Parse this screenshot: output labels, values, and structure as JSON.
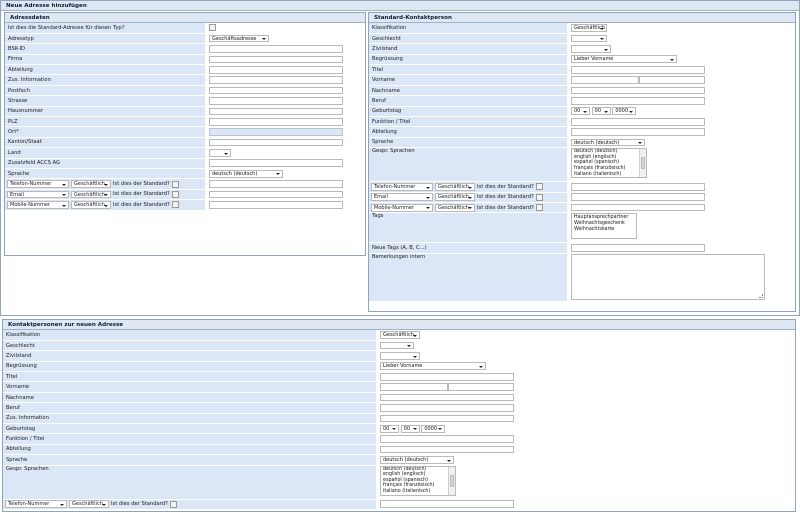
{
  "page": {
    "title": "Neue Adresse hinzufügen"
  },
  "address": {
    "title": "Adressdaten",
    "standard_question": "Ist dies die Standard-Adresse für diesen Typ?",
    "labels": [
      "Adresstyp",
      "BSK-ID",
      "Firma",
      "Abteilung",
      "Zus. Information",
      "Postfach",
      "Strasse",
      "Hausnummer",
      "PLZ",
      "Ort*",
      "Kanton/Staat",
      "Land",
      "Zusatzfeld ACCS AG",
      "Sprache"
    ],
    "adresstyp_value": "Geschäftsadresse",
    "sprache_value": "deutsch (deutsch)",
    "comm": [
      {
        "type": "Telefon-Nummer",
        "scope": "Geschäftlich",
        "question": "Ist dies der Standard?"
      },
      {
        "type": "Email",
        "scope": "Geschäftlich",
        "question": "Ist dies der Standard?"
      },
      {
        "type": "Mobile-Nummer",
        "scope": "Geschäftlich",
        "question": "Ist dies der Standard?"
      }
    ]
  },
  "standard_contact": {
    "title": "Standard-Kontaktperson",
    "labels": {
      "klassifikation": "Klassifikation",
      "geschlecht": "Geschlecht",
      "zivilstand": "Zivilstand",
      "begruessung": "Begrüssung",
      "titel": "Titel",
      "vorname": "Vorname",
      "nachname": "Nachname",
      "beruf": "Beruf",
      "geburtstag": "Geburtstag",
      "funktion": "Funktion / Titel",
      "abteilung": "Abteilung",
      "sprache": "Sprache",
      "gespr_sprachen": "Gespr. Sprachen",
      "tags": "Tags",
      "neue_tags": "Neue Tags (A, B, C...)",
      "bemerkungen": "Bemerkungen intern"
    },
    "klassifikation_value": "Geschäftlich",
    "begruessung_value": "Lieber Vorname",
    "birthday": {
      "day": "00",
      "month": "00",
      "year": "0000"
    },
    "sprache_value": "deutsch (deutsch)",
    "languages": [
      "deutsch (deutsch)",
      "english (englisch)",
      "español (spanisch)",
      "français (französisch)",
      "italiano (italienisch)"
    ],
    "tags": [
      "Hauptansprechpartner",
      "Weihnachtsgeschenk",
      "Weihnachtskarte"
    ],
    "comm": [
      {
        "type": "Telefon-Nummer",
        "scope": "Geschäftlich",
        "question": "Ist dies der Standard?"
      },
      {
        "type": "Email",
        "scope": "Geschäftlich",
        "question": "Ist dies der Standard?"
      },
      {
        "type": "Mobile-Nummer",
        "scope": "Geschäftlich",
        "question": "Ist dies der Standard?"
      }
    ]
  },
  "contacts": {
    "title": "Kontaktpersonen zur neuen Adresse",
    "labels": {
      "klassifikation": "Klassifikation",
      "geschlecht": "Geschlecht",
      "zivilstand": "Zivilstand",
      "begruessung": "Begrüssung",
      "titel": "Titel",
      "vorname": "Vorname",
      "nachname": "Nachname",
      "beruf": "Beruf",
      "zus_info": "Zus. Information",
      "geburtstag": "Geburtstag",
      "funktion": "Funktion / Titel",
      "abteilung": "Abteilung",
      "sprache": "Sprache",
      "gespr_sprachen": "Gespr. Sprachen"
    },
    "klassifikation_value": "Geschäftlich",
    "begruessung_value": "Lieber Vorname",
    "birthday": {
      "day": "00",
      "month": "00",
      "year": "0000"
    },
    "sprache_value": "deutsch (deutsch)",
    "languages": [
      "deutsch (deutsch)",
      "english (englisch)",
      "español (spanisch)",
      "français (französisch)",
      "italiano (italienisch)"
    ],
    "comm": {
      "type": "Telefon-Nummer",
      "scope": "Geschäftlich",
      "question": "Ist dies der Standard?"
    }
  },
  "colors": {
    "label_bg": "#dbe6f6",
    "header_bg": "#dfe8f2",
    "border": "#8ea5c2"
  }
}
